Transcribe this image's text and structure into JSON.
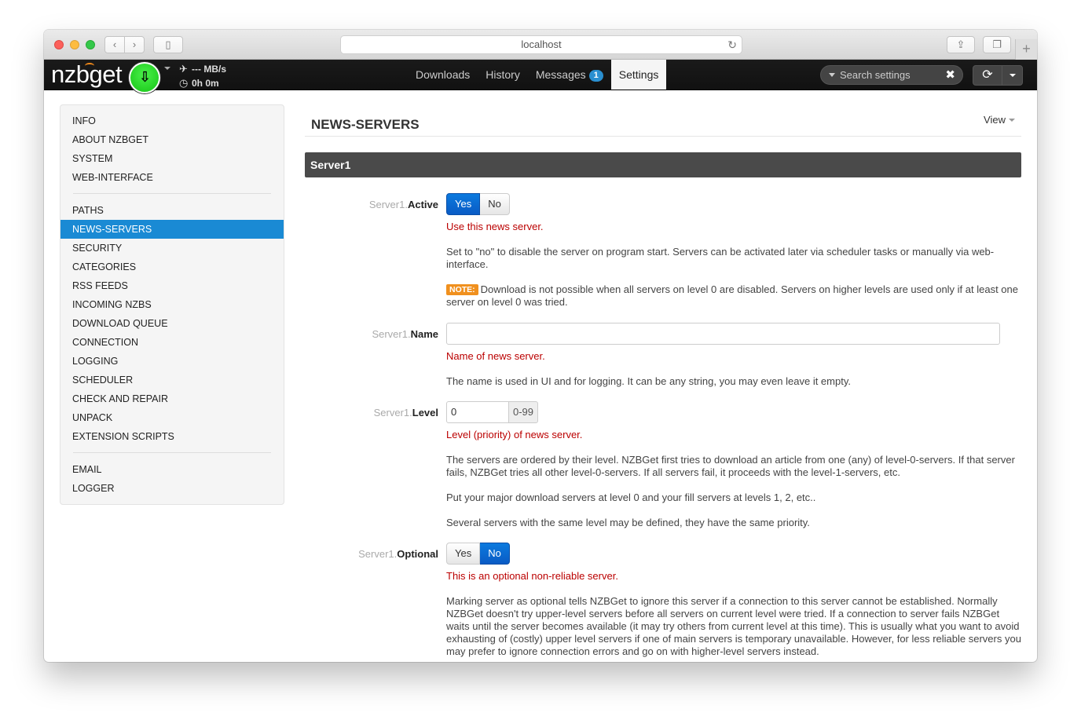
{
  "browser": {
    "url": "localhost"
  },
  "navbar": {
    "logo": "nzbget",
    "speed": "--- MB/s",
    "time_left": "0h 0m",
    "menu": [
      {
        "label": "Downloads"
      },
      {
        "label": "History"
      },
      {
        "label": "Messages",
        "badge": "1"
      },
      {
        "label": "Settings",
        "active": true
      }
    ],
    "search_placeholder": "Search settings"
  },
  "sidebar": {
    "group1": [
      "INFO",
      "ABOUT NZBGET",
      "SYSTEM",
      "WEB-INTERFACE"
    ],
    "group2": [
      "PATHS",
      "NEWS-SERVERS",
      "SECURITY",
      "CATEGORIES",
      "RSS FEEDS",
      "INCOMING NZBS",
      "DOWNLOAD QUEUE",
      "CONNECTION",
      "LOGGING",
      "SCHEDULER",
      "CHECK AND REPAIR",
      "UNPACK",
      "EXTENSION SCRIPTS"
    ],
    "group3": [
      "EMAIL",
      "LOGGER"
    ],
    "active": "NEWS-SERVERS"
  },
  "main": {
    "title": "NEWS-SERVERS",
    "view_label": "View",
    "section": "Server1",
    "options": {
      "active": {
        "prefix": "Server1.",
        "name": "Active",
        "yes": "Yes",
        "no": "No",
        "selected": "Yes",
        "short": "Use this news server.",
        "desc1": "Set to \"no\" to disable the server on program start. Servers can be activated later via scheduler tasks or manually via web-interface.",
        "note_label": "NOTE:",
        "note": "Download is not possible when all servers on level 0 are disabled. Servers on higher levels are used only if at least one server on level 0 was tried."
      },
      "name": {
        "prefix": "Server1.",
        "name": "Name",
        "value": "",
        "short": "Name of news server.",
        "desc1": "The name is used in UI and for logging. It can be any string, you may even leave it empty."
      },
      "level": {
        "prefix": "Server1.",
        "name": "Level",
        "value": "0",
        "range": "0-99",
        "short": "Level (priority) of news server.",
        "desc1": "The servers are ordered by their level. NZBGet first tries to download an article from one (any) of level-0-servers. If that server fails, NZBGet tries all other level-0-servers. If all servers fail, it proceeds with the level-1-servers, etc.",
        "desc2": "Put your major download servers at level 0 and your fill servers at levels 1, 2, etc..",
        "desc3": "Several servers with the same level may be defined, they have the same priority."
      },
      "optional": {
        "prefix": "Server1.",
        "name": "Optional",
        "yes": "Yes",
        "no": "No",
        "selected": "No",
        "short": "This is an optional non-reliable server.",
        "desc1": "Marking server as optional tells NZBGet to ignore this server if a connection to this server cannot be established. Normally NZBGet doesn't try upper-level servers before all servers on current level were tried. If a connection to server fails NZBGet waits until the server becomes available (it may try others from current level at this time). This is usually what you want to avoid exhausting of (costly) upper level servers if one of main servers is temporary unavailable. However, for less reliable servers you may prefer to ignore connection errors and go on with higher-level servers instead."
      }
    }
  },
  "colors": {
    "accent": "#1a8ad4",
    "toggle_on": "#0a5bc5",
    "short_desc": "#bb0000",
    "note": "#f0901e",
    "navbar": "#111111"
  }
}
